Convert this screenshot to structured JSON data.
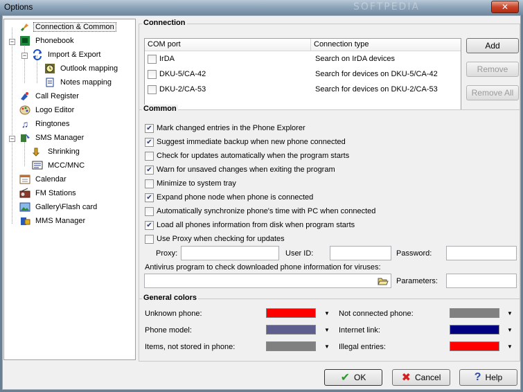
{
  "window": {
    "title": "Options",
    "close_glyph": "✕",
    "watermark": "SOFTPEDIA"
  },
  "tree": {
    "items": [
      {
        "label": "Connection & Common",
        "icon": "connection-icon"
      },
      {
        "label": "Phonebook",
        "icon": "phonebook-icon"
      },
      {
        "label": "Import & Export",
        "icon": "import-export-icon"
      },
      {
        "label": "Outlook mapping",
        "icon": "outlook-icon"
      },
      {
        "label": "Notes mapping",
        "icon": "notes-icon"
      },
      {
        "label": "Call Register",
        "icon": "call-register-icon"
      },
      {
        "label": "Logo Editor",
        "icon": "logo-editor-icon"
      },
      {
        "label": "Ringtones",
        "icon": "ringtones-icon"
      },
      {
        "label": "SMS Manager",
        "icon": "sms-icon"
      },
      {
        "label": "Shrinking",
        "icon": "shrinking-icon"
      },
      {
        "label": "MCC/MNC",
        "icon": "mcc-mnc-icon"
      },
      {
        "label": "Calendar",
        "icon": "calendar-icon"
      },
      {
        "label": "FM Stations",
        "icon": "radio-icon"
      },
      {
        "label": "Gallery\\Flash card",
        "icon": "gallery-icon"
      },
      {
        "label": "MMS Manager",
        "icon": "mms-icon"
      }
    ],
    "expander_minus": "−"
  },
  "connection": {
    "title": "Connection",
    "columns": [
      "COM port",
      "Connection type"
    ],
    "rows": [
      {
        "port": "IrDA",
        "type": "Search on IrDA devices"
      },
      {
        "port": "DKU-5/CA-42",
        "type": "Search for devices on DKU-5/CA-42"
      },
      {
        "port": "DKU-2/CA-53",
        "type": "Search for devices on DKU-2/CA-53"
      }
    ],
    "add": "Add",
    "remove": "Remove",
    "remove_all": "Remove All"
  },
  "common": {
    "title": "Common",
    "options": [
      {
        "label": "Mark changed entries in the Phone Explorer",
        "checked": true
      },
      {
        "label": "Suggest immediate backup when new phone connected",
        "checked": true
      },
      {
        "label": "Check for updates automatically when the program starts",
        "checked": false
      },
      {
        "label": "Warn for unsaved changes when exiting the program",
        "checked": true
      },
      {
        "label": "Minimize to system tray",
        "checked": false
      },
      {
        "label": "Expand phone node when phone is connected",
        "checked": true
      },
      {
        "label": "Automatically synchronize phone's time with PC when connected",
        "checked": false
      },
      {
        "label": "Load all phones information from disk when program starts",
        "checked": true
      }
    ],
    "use_proxy": "Use Proxy when checking for updates",
    "proxy_label": "Proxy:",
    "userid_label": "User ID:",
    "password_label": "Password:",
    "antivirus_label": "Antivirus program to check downloaded phone information for viruses:",
    "parameters_label": "Parameters:"
  },
  "colors": {
    "title": "General colors",
    "items": [
      {
        "label": "Unknown phone:",
        "color": "#ff0000"
      },
      {
        "label": "Phone model:",
        "color": "#5f5f8f"
      },
      {
        "label": "Items, not stored in phone:",
        "color": "#808080"
      },
      {
        "label": "Not connected phone:",
        "color": "#808080"
      },
      {
        "label": "Internet link:",
        "color": "#000080"
      },
      {
        "label": "Illegal entries:",
        "color": "#ff0000"
      }
    ],
    "dropdown_glyph": "▼"
  },
  "buttons": {
    "ok": "OK",
    "cancel": "Cancel",
    "help": "Help"
  }
}
